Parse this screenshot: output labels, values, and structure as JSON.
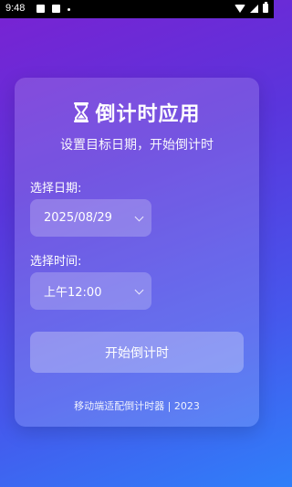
{
  "status_bar": {
    "time": "9:48"
  },
  "app": {
    "title": "倒计时应用",
    "subtitle": "设置目标日期，开始倒计时",
    "date_label": "选择日期:",
    "date_value": "2025/08/29",
    "time_label": "选择时间:",
    "time_value": "上午12:00",
    "start_button": "开始倒计时",
    "footer": "移动端适配倒计时器 | 2023"
  },
  "colors": {
    "gradient_start": "#7a22d2",
    "gradient_end": "#2f7ff9"
  }
}
